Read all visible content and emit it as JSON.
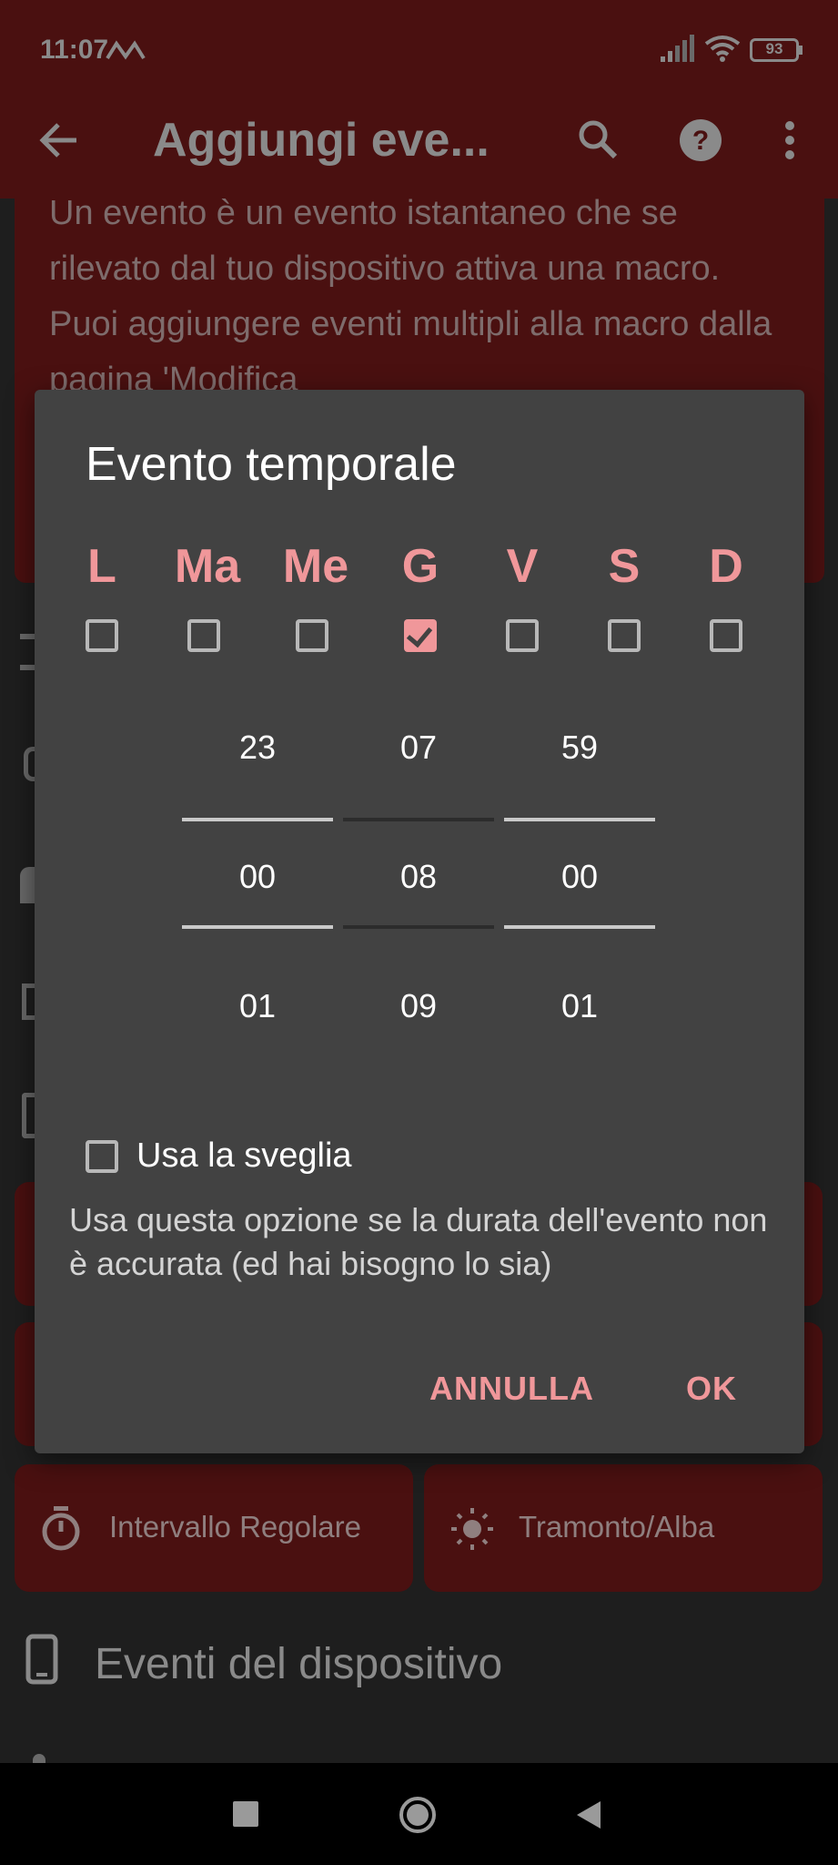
{
  "status_bar": {
    "time": "11:07",
    "battery": "93",
    "icons": [
      "notification-icon",
      "signal-icon",
      "wifi-icon",
      "battery-icon"
    ]
  },
  "app_bar": {
    "title": "Aggiungi eve...",
    "icons": [
      "back-arrow-icon",
      "search-icon",
      "help-icon",
      "more-vert-icon"
    ]
  },
  "background": {
    "info_text": "Un evento è un evento istantaneo che se rilevato dal tuo dispositivo attiva una macro. Puoi aggiungere eventi multipli alla macro dalla pagina 'Modifica",
    "buttons": [
      {
        "label": "Intervallo Regolare",
        "icon": "timer-icon"
      },
      {
        "label": "Tramonto/Alba",
        "icon": "sun-icon"
      }
    ],
    "section_label": "Eventi del dispositivo",
    "section_icon": "phone-icon"
  },
  "dialog": {
    "title": "Evento temporale",
    "days": [
      {
        "label": "L",
        "checked": false
      },
      {
        "label": "Ma",
        "checked": false
      },
      {
        "label": "Me",
        "checked": false
      },
      {
        "label": "G",
        "checked": true
      },
      {
        "label": "V",
        "checked": false
      },
      {
        "label": "S",
        "checked": false
      },
      {
        "label": "D",
        "checked": false
      }
    ],
    "picker": {
      "hours": {
        "prev": "23",
        "current": "00",
        "next": "01"
      },
      "minutes": {
        "prev": "07",
        "current": "08",
        "next": "09"
      },
      "seconds": {
        "prev": "59",
        "current": "00",
        "next": "01"
      }
    },
    "alarm_option": {
      "label": "Usa la sveglia",
      "checked": false
    },
    "description": "Usa questa opzione se la durata dell'evento non è accurata (ed hai bisogno lo sia)",
    "cancel_label": "ANNULLA",
    "ok_label": "OK"
  },
  "colors": {
    "accent": "#f0979a",
    "app_bar": "#4a1010",
    "dialog_bg": "#424242"
  }
}
